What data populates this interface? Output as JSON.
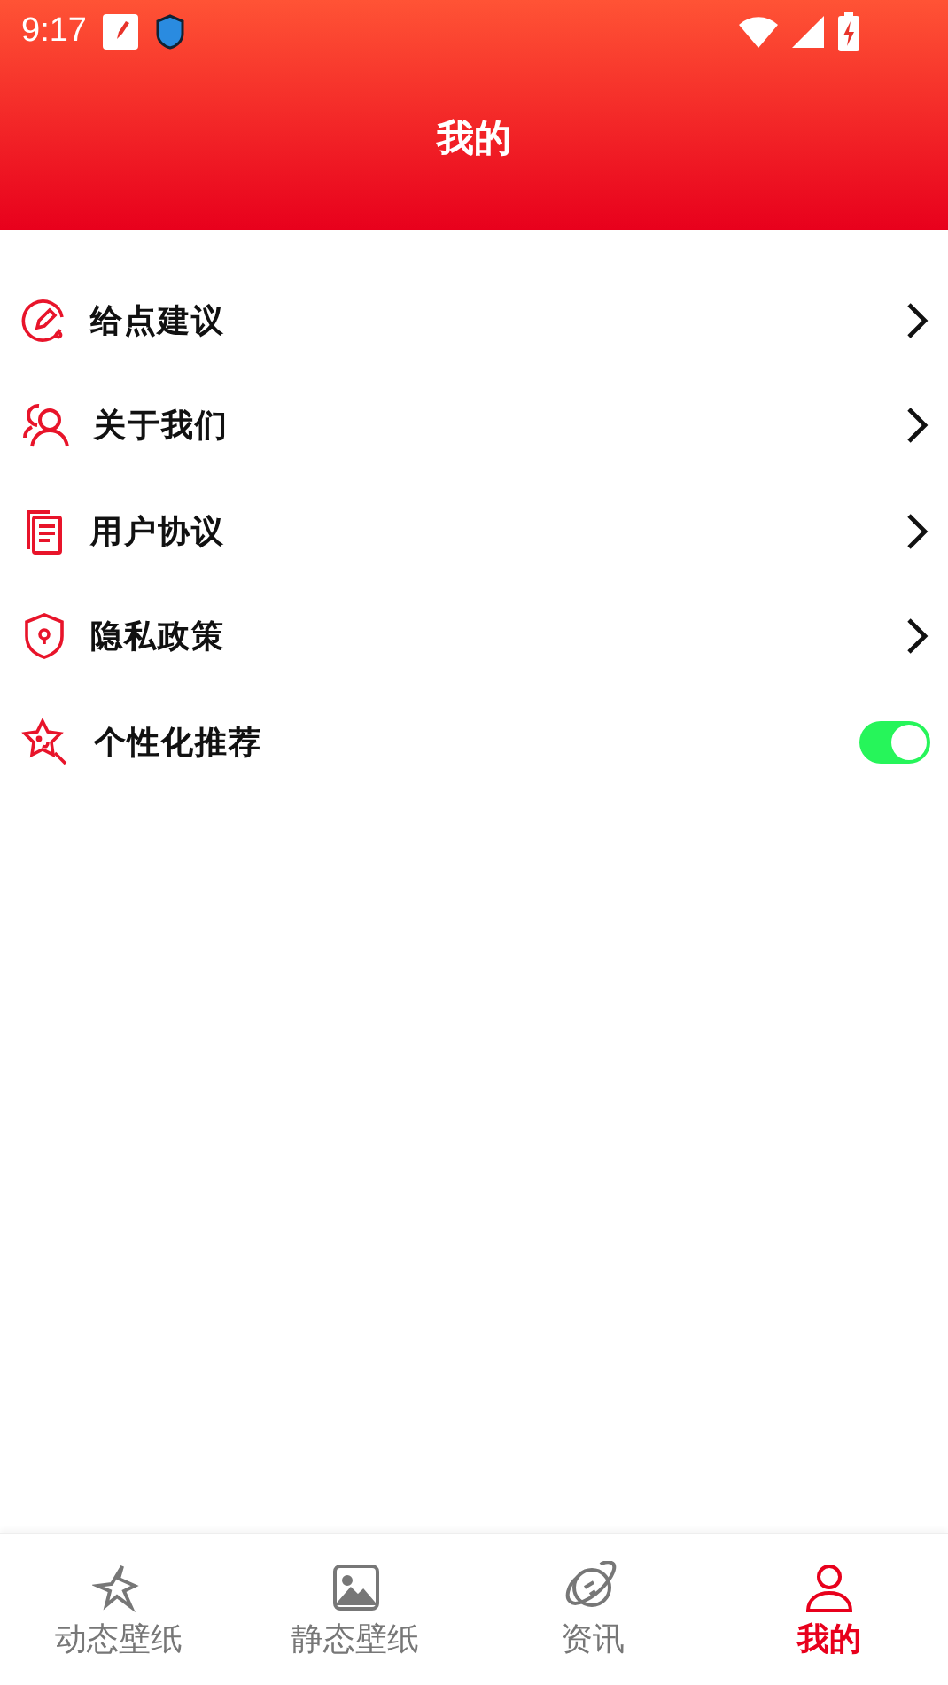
{
  "status_bar": {
    "time": "9:17"
  },
  "header": {
    "title": "我的"
  },
  "menu": [
    {
      "kind": "link",
      "label": "给点建议"
    },
    {
      "kind": "link",
      "label": "关于我们"
    },
    {
      "kind": "link",
      "label": "用户协议"
    },
    {
      "kind": "link",
      "label": "隐私政策"
    },
    {
      "kind": "toggle",
      "label": "个性化推荐",
      "on": true
    }
  ],
  "tabs": [
    {
      "label": "动态壁纸",
      "selected": false
    },
    {
      "label": "静态壁纸",
      "selected": false
    },
    {
      "label": "资讯",
      "selected": false
    },
    {
      "label": "我的",
      "selected": true
    }
  ]
}
